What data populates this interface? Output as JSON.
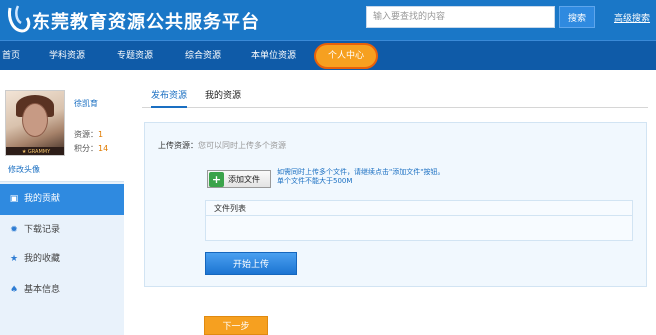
{
  "header": {
    "site_title": "东莞教育资源公共服务平台",
    "search_placeholder": "输入要查找的内容",
    "search_button": "搜索",
    "advanced_search": "高级搜索",
    "logo_icon": "swirl-logo-icon"
  },
  "nav": {
    "items": [
      "首页",
      "学科资源",
      "专题资源",
      "综合资源",
      "本单位资源",
      "个人中心"
    ],
    "active_index": 5,
    "active_color": "#f6a020",
    "bar_color": "#0f5ba8"
  },
  "profile": {
    "username": "徐凯育",
    "resources_label": "资源：",
    "resources_value": "1",
    "points_label": "积分：",
    "points_value": "14",
    "edit_avatar": "修改头像"
  },
  "sidebar_menu": [
    {
      "label": "我的贡献",
      "icon": "monitor-icon",
      "active": true
    },
    {
      "label": "下载记录",
      "icon": "gear-icon",
      "active": false
    },
    {
      "label": "我的收藏",
      "icon": "star-icon",
      "active": false
    },
    {
      "label": "基本信息",
      "icon": "user-icon",
      "active": false
    }
  ],
  "tabs": [
    {
      "label": "发布资源",
      "active": true
    },
    {
      "label": "我的资源",
      "active": false
    }
  ],
  "upload": {
    "label": "上传资源：",
    "hint": "您可以同时上传多个资源",
    "add_file_button": "添加文件",
    "note_line1": "如需同时上传多个文件，请继续点击\"添加文件\"按钮。",
    "note_line2": "单个文件不能大于500M",
    "file_list_title": "文件列表",
    "start_upload_button": "开始上传"
  },
  "next_button": "下一步"
}
